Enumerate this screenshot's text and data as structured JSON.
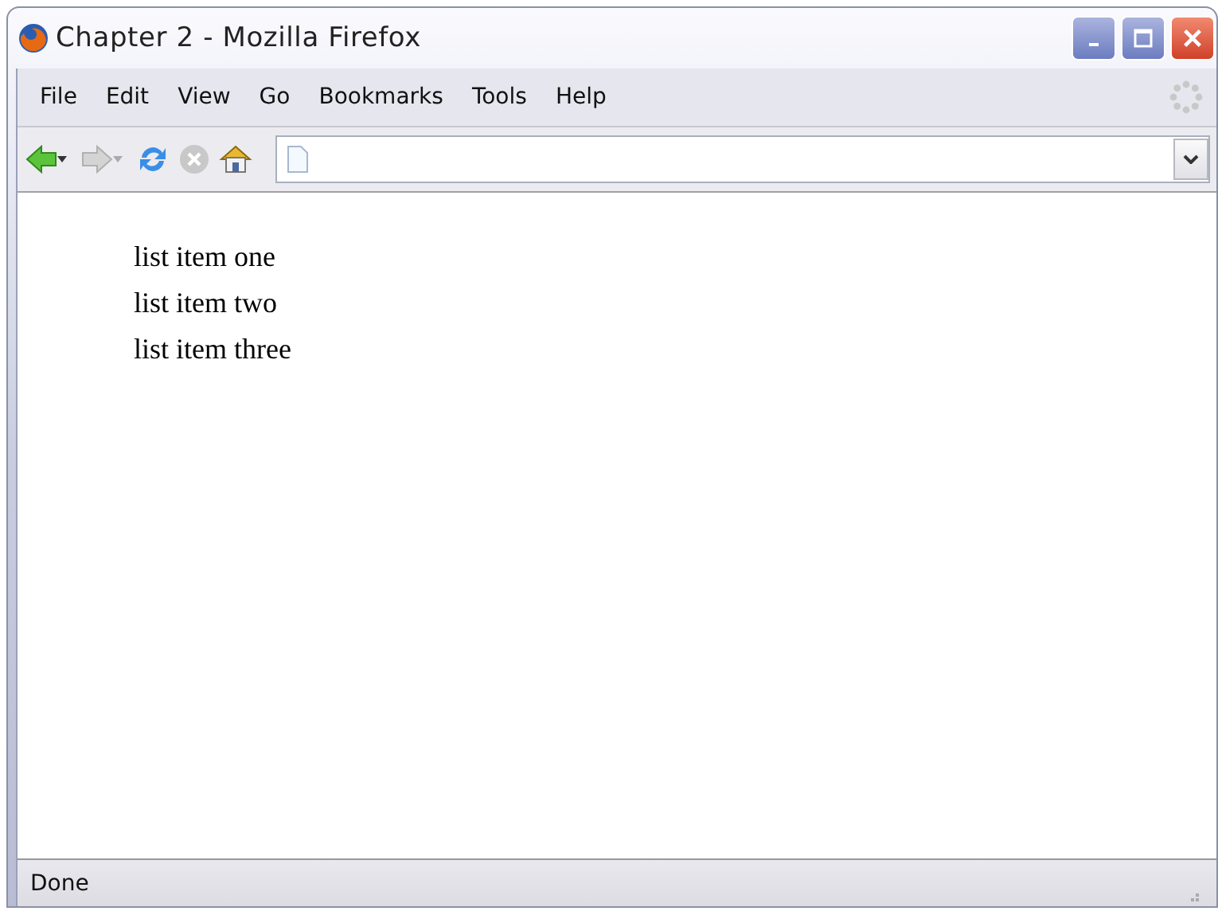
{
  "window": {
    "title": "Chapter 2 - Mozilla Firefox"
  },
  "menu": [
    "File",
    "Edit",
    "View",
    "Go",
    "Bookmarks",
    "Tools",
    "Help"
  ],
  "toolbar": [
    {
      "kind": "back",
      "disabled": false,
      "dropdown": true
    },
    {
      "kind": "forward",
      "disabled": true,
      "dropdown": true
    },
    {
      "kind": "reload",
      "disabled": false,
      "dropdown": false
    },
    {
      "kind": "stop",
      "disabled": true,
      "dropdown": false
    },
    {
      "kind": "home",
      "disabled": false,
      "dropdown": false
    }
  ],
  "content": {
    "list": [
      "list item one",
      "list item two",
      "list item three"
    ]
  },
  "status_bar": {
    "text": "Done"
  }
}
